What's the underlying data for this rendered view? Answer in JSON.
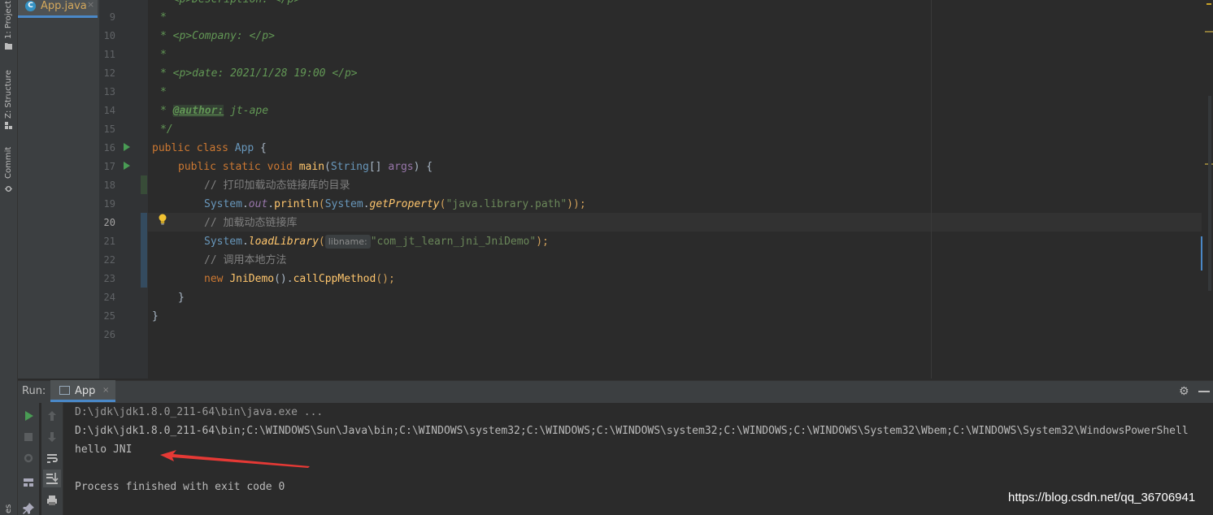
{
  "tool_windows": {
    "project": "1: Project",
    "structure": "Z: Structure",
    "commit": "Commit",
    "favorites": "es"
  },
  "editor_tab": {
    "icon": "C",
    "file_name": "App.java",
    "close": "×"
  },
  "editor": {
    "line_numbers": [
      "9",
      "10",
      "11",
      "12",
      "13",
      "14",
      "15",
      "16",
      "17",
      "18",
      "19",
      "20",
      "21",
      "22",
      "23",
      "24",
      "25",
      "26"
    ],
    "current_line": "20",
    "top_partial": "* <p>Description: </p>",
    "lines": {
      "l9": "*",
      "l10_tag": "<p>",
      "l10_text": "Company: ",
      "l10_end": "</p>",
      "l11": "*",
      "l12_tag": "<p>",
      "l12_text": "date: 2021/1/28 19:00 ",
      "l12_end": "</p>",
      "l13": "*",
      "l14_ann": "@author:",
      "l14_text": " jt-ape",
      "l15": "*/",
      "l16_kw": "public class ",
      "l16_cls": "App",
      "l16_end": " {",
      "l17_kw": "public static void ",
      "l17_fn": "main",
      "l17_p1": "(",
      "l17_type": "String",
      "l17_p2": "[] ",
      "l17_arg": "args",
      "l17_end": ") {",
      "l18": "// 打印加载动态链接库的目录",
      "l19_sys": "System",
      "l19_dot": ".",
      "l19_out": "out",
      "l19_dot2": ".",
      "l19_fn": "println",
      "l19_p": "(",
      "l19_sys2": "System",
      "l19_dot3": ".",
      "l19_fn2": "getProperty",
      "l19_p2": "(",
      "l19_str": "\"java.library.path\"",
      "l19_end": "));",
      "l20": "// 加载动态链接库",
      "l21_sys": "System",
      "l21_dot": ".",
      "l21_fn": "loadLibrary",
      "l21_p": "(",
      "l21_hint": "libname:",
      "l21_str": "\"com_jt_learn_jni_JniDemo\"",
      "l21_end": ");",
      "l22": "// 调用本地方法",
      "l23_kw": "new ",
      "l23_cls": "JniDemo",
      "l23_p": "().",
      "l23_fn": "callCppMethod",
      "l23_end": "();",
      "l24": "}",
      "l25": "}"
    }
  },
  "run_panel": {
    "label": "Run:",
    "tab_name": "App",
    "tab_close": "×",
    "settings_icon": "⚙",
    "console_lines": [
      "D:\\jdk\\jdk1.8.0_211-64\\bin\\java.exe ...",
      "D:\\jdk\\jdk1.8.0_211-64\\bin;C:\\WINDOWS\\Sun\\Java\\bin;C:\\WINDOWS\\system32;C:\\WINDOWS;C:\\WINDOWS\\system32;C:\\WINDOWS;C:\\WINDOWS\\System32\\Wbem;C:\\WINDOWS\\System32\\WindowsPowerShell",
      "hello JNI",
      "",
      "Process finished with exit code 0"
    ]
  },
  "watermark": "https://blog.csdn.net/qq_36706941",
  "colors": {
    "accent": "#4a88c7",
    "annotation_arrow": "#e53935",
    "run_green": "#499c54"
  }
}
